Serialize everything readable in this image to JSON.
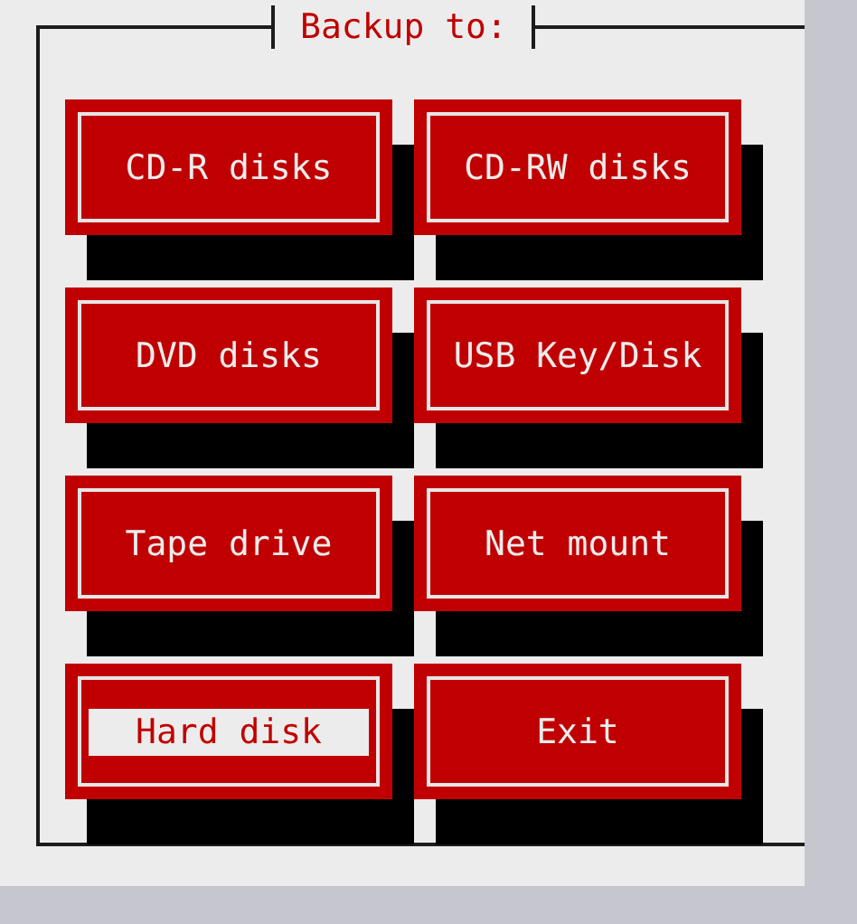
{
  "dialog": {
    "title": "Backup to:"
  },
  "buttons": [
    {
      "label": "CD-R disks",
      "selected": false
    },
    {
      "label": "CD-RW disks",
      "selected": false
    },
    {
      "label": "DVD disks",
      "selected": false
    },
    {
      "label": "USB Key/Disk",
      "selected": false
    },
    {
      "label": "Tape drive",
      "selected": false
    },
    {
      "label": "Net mount",
      "selected": false
    },
    {
      "label": "Hard disk",
      "selected": true
    },
    {
      "label": "Exit",
      "selected": false
    }
  ]
}
